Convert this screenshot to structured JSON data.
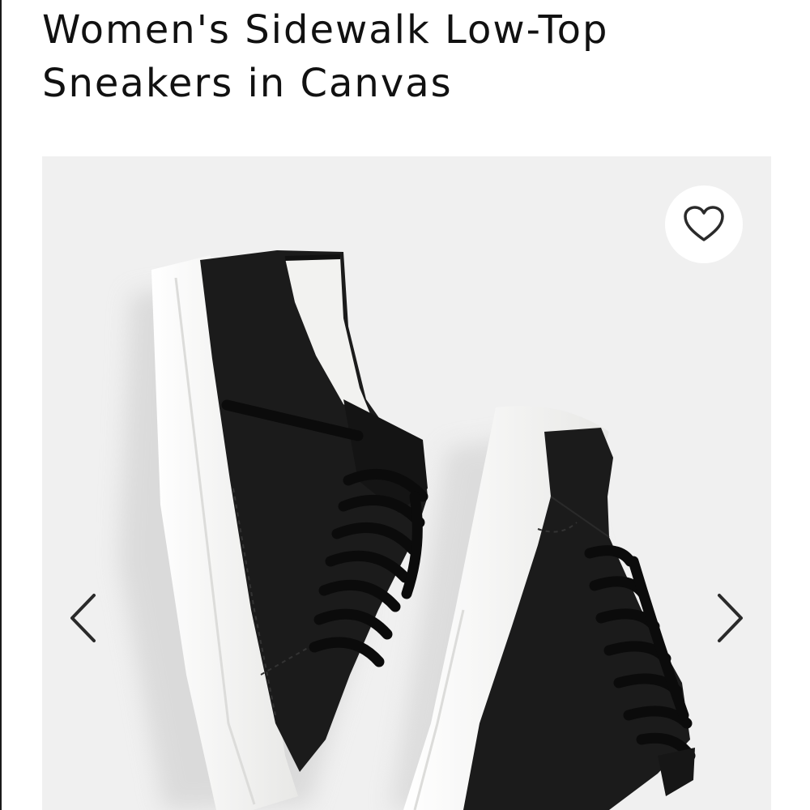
{
  "product": {
    "title": "Women's Sidewalk Low-Top Sneakers in Canvas"
  },
  "gallery": {
    "image_subject": "black canvas low-top sneakers with white soles and black laces",
    "favorite_icon": "heart-outline-icon",
    "prev_icon": "chevron-left-icon",
    "next_icon": "chevron-right-icon"
  },
  "colors": {
    "text": "#111111",
    "gallery_background": "#f0f0f0",
    "canvas_black": "#1b1b1b",
    "sole_white": "#f6f6f4",
    "icon_stroke": "#2a2a2a"
  }
}
